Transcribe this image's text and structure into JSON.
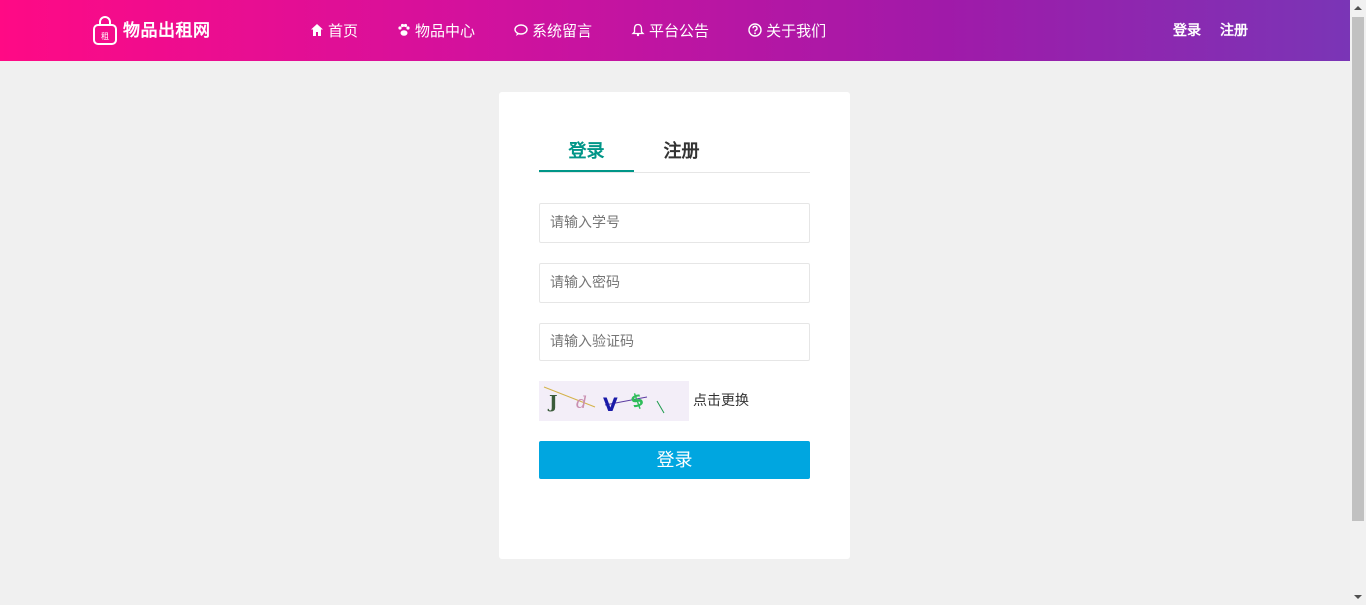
{
  "header": {
    "brand": {
      "name": "物品出租网",
      "logo_char": "租"
    },
    "nav": [
      {
        "label": "首页",
        "icon": "home-icon"
      },
      {
        "label": "物品中心",
        "icon": "paw-icon"
      },
      {
        "label": "系统留言",
        "icon": "chat-bubble-icon"
      },
      {
        "label": "平台公告",
        "icon": "bell-icon"
      },
      {
        "label": "关于我们",
        "icon": "question-circle-icon"
      }
    ],
    "auth": {
      "login": "登录",
      "register": "注册"
    },
    "colors": {
      "gradient_start": "#ff0a85",
      "gradient_end": "#7a35b6"
    }
  },
  "login_card": {
    "tabs": [
      {
        "label": "登录",
        "active": true
      },
      {
        "label": "注册",
        "active": false
      }
    ],
    "fields": {
      "student_id": {
        "placeholder": "请输入学号",
        "value": ""
      },
      "password": {
        "placeholder": "请输入密码",
        "value": ""
      },
      "captcha": {
        "placeholder": "请输入验证码",
        "value": ""
      }
    },
    "captcha_image": {
      "text": "JdV$\\"
    },
    "captcha_refresh": "点击更换",
    "submit_label": "登录",
    "colors": {
      "active_tab": "#009688",
      "button": "#00a6e0"
    }
  }
}
